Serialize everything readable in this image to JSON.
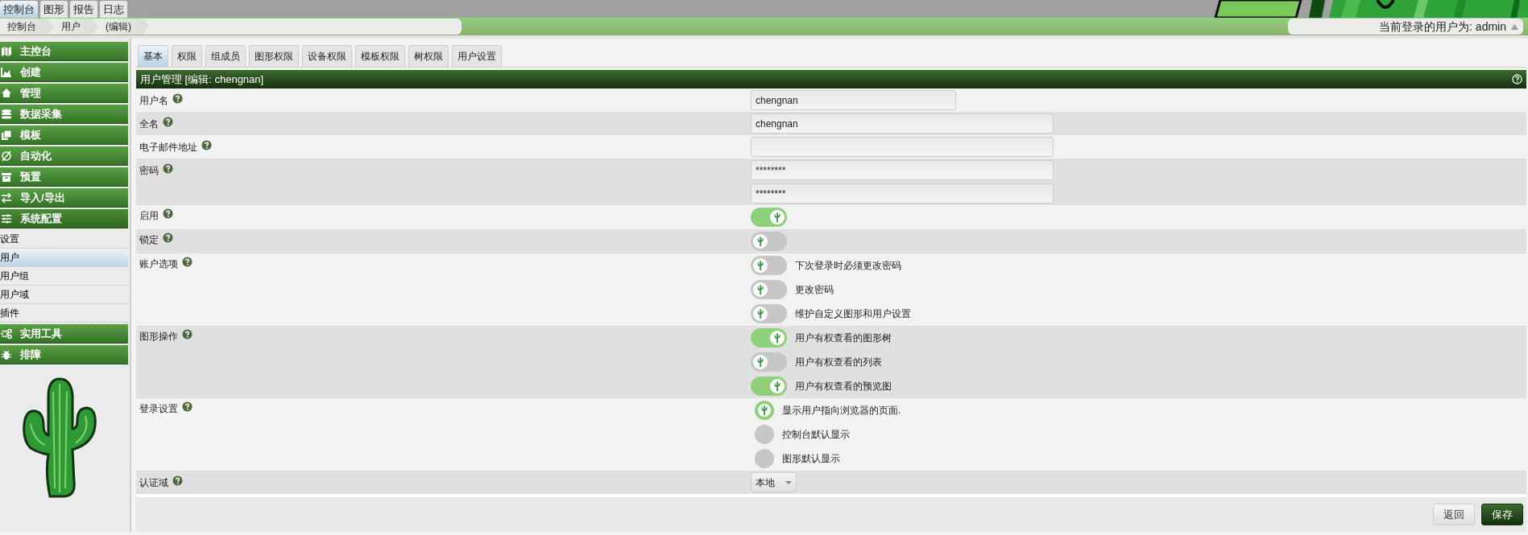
{
  "top_tabs": [
    {
      "label": "控制台",
      "selected": true
    },
    {
      "label": "图形",
      "selected": false
    },
    {
      "label": "报告",
      "selected": false
    },
    {
      "label": "日志",
      "selected": false
    }
  ],
  "breadcrumbs": [
    "控制台",
    "用户",
    "(编辑)"
  ],
  "user_menu": {
    "label": "当前登录的用户为: admin"
  },
  "sidebar": {
    "items": [
      {
        "label": "主控台",
        "expanded": false
      },
      {
        "label": "创建",
        "expanded": false
      },
      {
        "label": "管理",
        "expanded": false
      },
      {
        "label": "数据采集",
        "expanded": false
      },
      {
        "label": "模板",
        "expanded": false
      },
      {
        "label": "自动化",
        "expanded": false
      },
      {
        "label": "预置",
        "expanded": false
      },
      {
        "label": "导入/导出",
        "expanded": false
      },
      {
        "label": "系统配置",
        "expanded": true,
        "children": [
          {
            "label": "设置",
            "selected": false
          },
          {
            "label": "用户",
            "selected": true
          },
          {
            "label": "用户组",
            "selected": false
          },
          {
            "label": "用户域",
            "selected": false
          },
          {
            "label": "插件",
            "selected": false
          }
        ]
      },
      {
        "label": "实用工具",
        "expanded": false
      },
      {
        "label": "排障",
        "expanded": false
      }
    ]
  },
  "tabs": [
    {
      "label": "基本",
      "selected": true
    },
    {
      "label": "权限",
      "selected": false
    },
    {
      "label": "组成员",
      "selected": false
    },
    {
      "label": "图形权限",
      "selected": false
    },
    {
      "label": "设备权限",
      "selected": false
    },
    {
      "label": "模板权限",
      "selected": false
    },
    {
      "label": "树权限",
      "selected": false
    },
    {
      "label": "用户设置",
      "selected": false
    }
  ],
  "panel": {
    "title": "用户管理 [编辑: chengnan]"
  },
  "rows": [
    {
      "label": "用户名",
      "kind": "short_text",
      "fields": [
        {
          "value": "chengnan"
        }
      ]
    },
    {
      "label": "全名",
      "kind": "text",
      "fields": [
        {
          "value": "chengnan"
        }
      ]
    },
    {
      "label": "电子邮件地址",
      "kind": "text"
    },
    {
      "label": "密码",
      "kind": "text",
      "fields": [
        {
          "value": "********"
        },
        {
          "value": "********"
        }
      ]
    },
    {
      "label": "启用",
      "kind": "toggle",
      "options": [
        {
          "on": true
        }
      ]
    },
    {
      "label": "锁定",
      "kind": "toggle",
      "options": [
        {
          "on": false
        }
      ]
    },
    {
      "label": "账户选项",
      "kind": "toggle",
      "options": [
        {
          "label": "下次登录时必须更改密码",
          "on": false
        },
        {
          "label": "更改密码",
          "on": false
        },
        {
          "label": "维护自定义图形和用户设置",
          "on": false
        }
      ]
    },
    {
      "label": "图形操作",
      "kind": "toggle",
      "options": [
        {
          "label": "用户有权查看的图形树",
          "on": true
        },
        {
          "label": "用户有权查看的列表",
          "on": false
        },
        {
          "label": "用户有权查看的预览图",
          "on": true
        }
      ]
    },
    {
      "label": "登录设置",
      "kind": "radio",
      "options": [
        {
          "label": "显示用户指向浏览器的页面.",
          "selected": true
        },
        {
          "label": "控制台默认显示",
          "selected": false
        },
        {
          "label": "图形默认显示",
          "selected": false
        }
      ]
    },
    {
      "label": "认证域",
      "kind": "select",
      "value": "本地"
    }
  ],
  "buttons": [
    {
      "label": "返回",
      "kind": "secondary"
    },
    {
      "label": "保存",
      "kind": "primary"
    }
  ]
}
